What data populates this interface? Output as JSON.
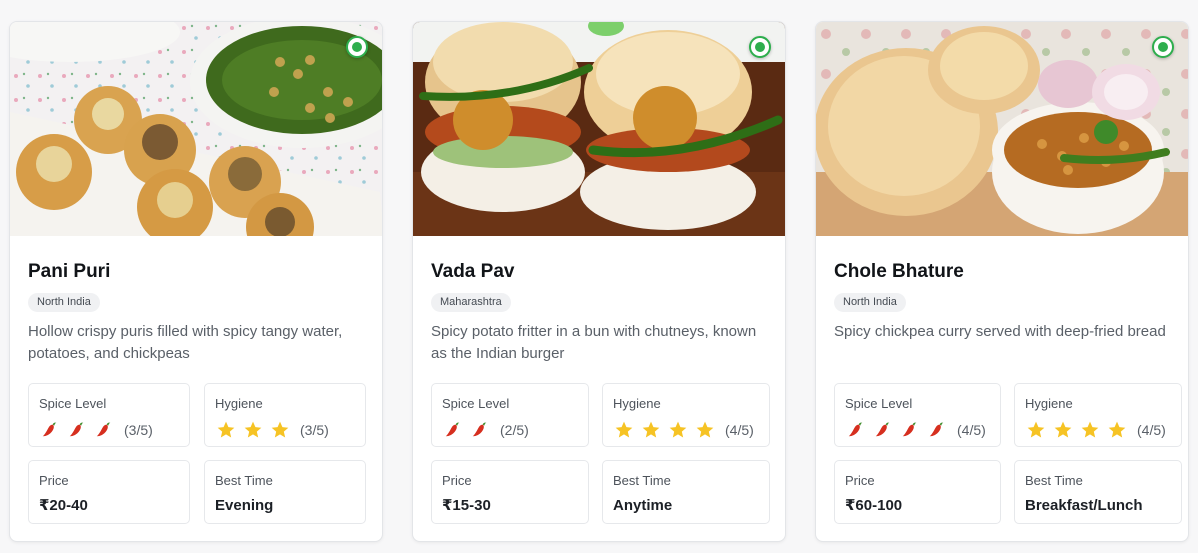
{
  "cards": [
    {
      "title": "Pani Puri",
      "region": "North India",
      "description": "Hollow crispy puris filled with spicy tangy water, potatoes, and chickpeas",
      "spice": {
        "label": "Spice Level",
        "level": 3,
        "max": 5,
        "text": "(3/5)"
      },
      "hygiene": {
        "label": "Hygiene",
        "level": 3,
        "max": 5,
        "text": "(3/5)"
      },
      "price": {
        "label": "Price",
        "value": "₹20-40"
      },
      "best_time": {
        "label": "Best Time",
        "value": "Evening"
      },
      "veg": true,
      "icon": "leaf-circle-icon"
    },
    {
      "title": "Vada Pav",
      "region": "Maharashtra",
      "description": "Spicy potato fritter in a bun with chutneys, known as the Indian burger",
      "spice": {
        "label": "Spice Level",
        "level": 2,
        "max": 5,
        "text": "(2/5)"
      },
      "hygiene": {
        "label": "Hygiene",
        "level": 4,
        "max": 5,
        "text": "(4/5)"
      },
      "price": {
        "label": "Price",
        "value": "₹15-30"
      },
      "best_time": {
        "label": "Best Time",
        "value": "Anytime"
      },
      "veg": true,
      "icon": "leaf-circle-icon"
    },
    {
      "title": "Chole Bhature",
      "region": "North India",
      "description": "Spicy chickpea curry served with deep-fried bread",
      "spice": {
        "label": "Spice Level",
        "level": 4,
        "max": 5,
        "text": "(4/5)"
      },
      "hygiene": {
        "label": "Hygiene",
        "level": 4,
        "max": 5,
        "text": "(4/5)"
      },
      "price": {
        "label": "Price",
        "value": "₹60-100"
      },
      "best_time": {
        "label": "Best Time",
        "value": "Breakfast/Lunch"
      },
      "veg": true,
      "icon": "leaf-circle-icon"
    }
  ],
  "colors": {
    "veg": "#2eae4d",
    "star": "#f6c324",
    "chili": "#d62f1f"
  }
}
